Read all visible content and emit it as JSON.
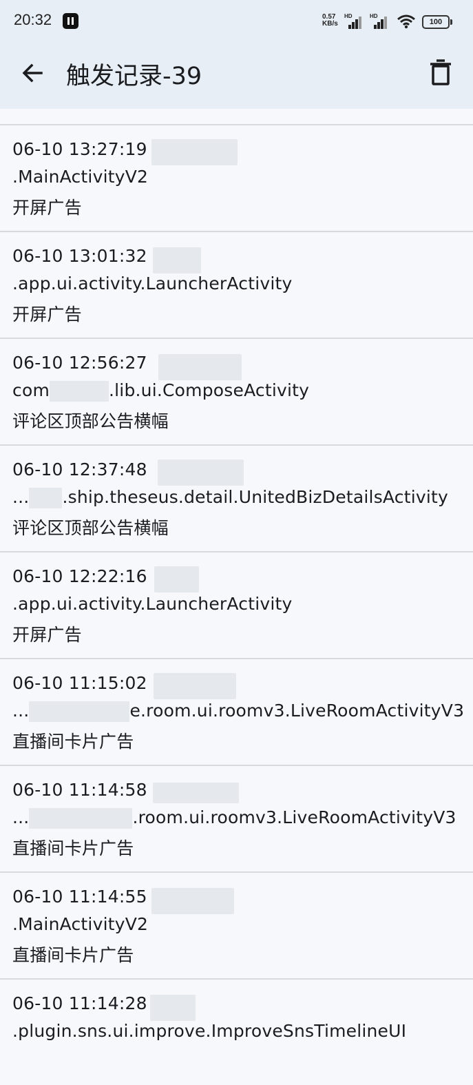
{
  "status_bar": {
    "time": "20:32",
    "net_speed_value": "0.57",
    "net_speed_unit": "KB/s",
    "signal_label": "HD",
    "battery": "100"
  },
  "app_bar": {
    "back_icon": "arrow-back-icon",
    "title": "触发记录-39",
    "delete_icon": "trash-icon"
  },
  "records": [
    {
      "time": "06-10 13:27:19",
      "activity": ".MainActivityV2",
      "rule": "开屏广告"
    },
    {
      "time": "06-10 13:01:32",
      "activity": ".app.ui.activity.LauncherActivity",
      "rule": "开屏广告"
    },
    {
      "time": "06-10 12:56:27",
      "activity_prefix": "com",
      "activity": ".lib.ui.ComposeActivity",
      "rule": "评论区顶部公告横幅"
    },
    {
      "time": "06-10 12:37:48",
      "activity_prefix": "...",
      "activity": ".ship.theseus.detail.UnitedBizDetailsActivity",
      "rule": "评论区顶部公告横幅"
    },
    {
      "time": "06-10 12:22:16",
      "activity": ".app.ui.activity.LauncherActivity",
      "rule": "开屏广告"
    },
    {
      "time": "06-10 11:15:02",
      "activity_prefix": "...",
      "activity": "e.room.ui.roomv3.LiveRoomActivityV3",
      "rule": "直播间卡片广告"
    },
    {
      "time": "06-10 11:14:58",
      "activity_prefix": "...",
      "activity": ".room.ui.roomv3.LiveRoomActivityV3",
      "rule": "直播间卡片广告"
    },
    {
      "time": "06-10 11:14:55",
      "activity": ".MainActivityV2",
      "rule": "直播间卡片广告"
    },
    {
      "time": "06-10 11:14:28",
      "activity": ".plugin.sns.ui.improve.ImproveSnsTimelineUI",
      "rule": ""
    }
  ]
}
